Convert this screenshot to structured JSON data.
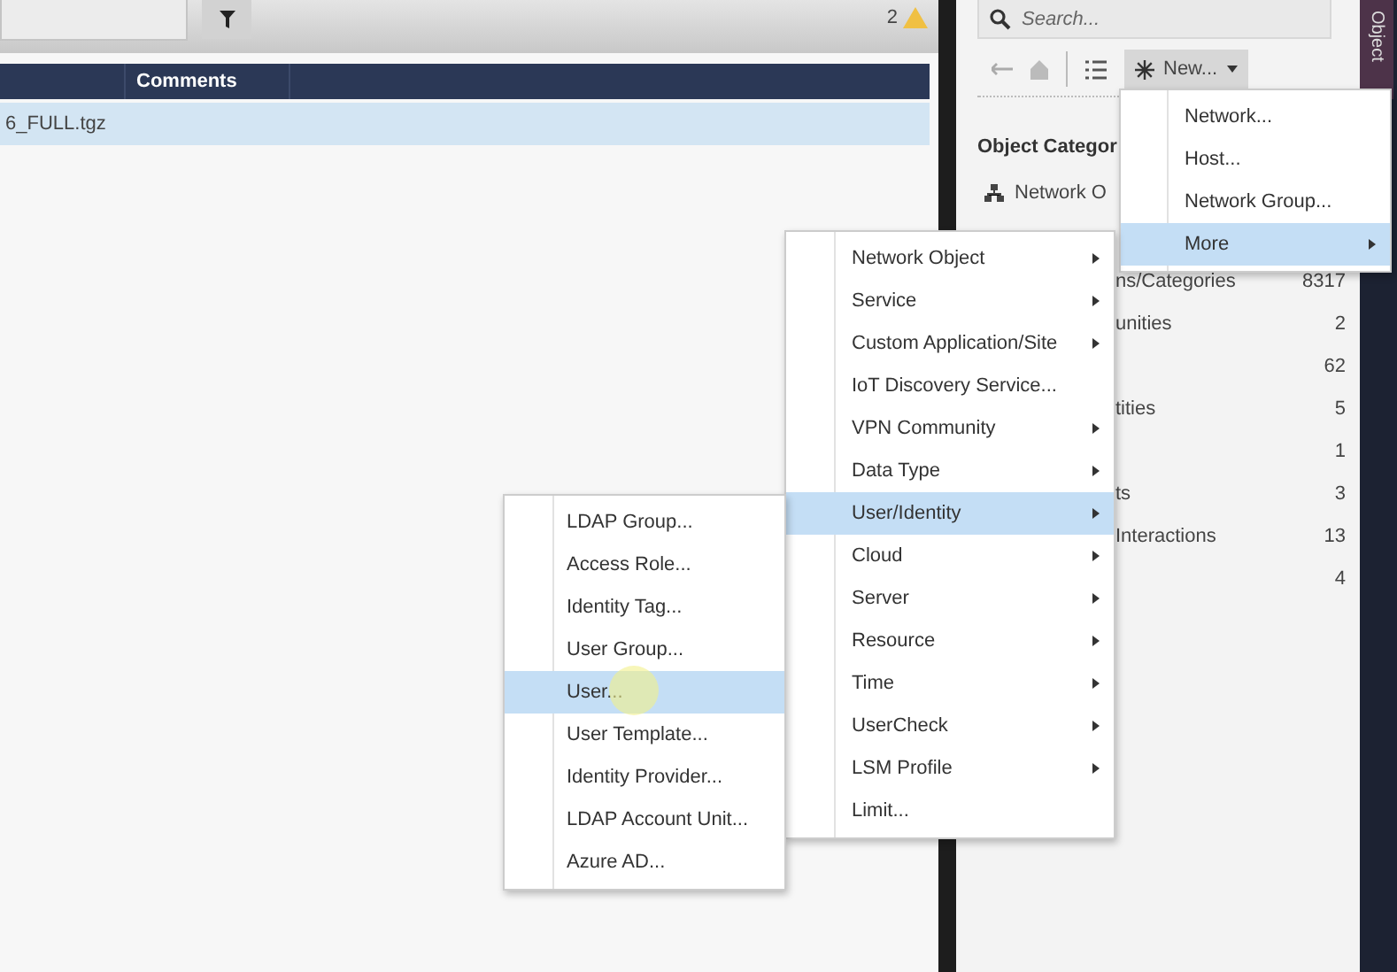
{
  "toolbar": {
    "warning_count": "2"
  },
  "table": {
    "columns": [
      "Comments"
    ],
    "rows": [
      {
        "column_1": "6_FULL.tgz",
        "selected": true
      }
    ]
  },
  "search": {
    "placeholder": "Search..."
  },
  "new_button": {
    "label": "New..."
  },
  "object_categories": {
    "title": "Object Categor",
    "items": [
      {
        "kind": "icon",
        "name": "Network O"
      },
      {
        "kind": "cut",
        "name": "ns/Categories",
        "count": "8317"
      },
      {
        "kind": "cut",
        "name": "unities",
        "count": "2"
      },
      {
        "kind": "cut",
        "count": "62"
      },
      {
        "kind": "cut",
        "name": "tities",
        "count": "5"
      },
      {
        "kind": "cut",
        "count": "1"
      },
      {
        "kind": "cut",
        "name": "ts",
        "count": "3"
      },
      {
        "kind": "cut",
        "name": "Interactions",
        "count": "13"
      },
      {
        "kind": "cut",
        "count": "4"
      }
    ]
  },
  "side_tab": {
    "label": "Object"
  },
  "menus": [
    {
      "items": [
        {
          "label": "Network...",
          "selected": false,
          "submenu": false
        },
        {
          "label": "Host...",
          "selected": false,
          "submenu": false
        },
        {
          "label": "Network Group...",
          "selected": false,
          "submenu": false
        },
        {
          "label": "More",
          "selected": true,
          "submenu": true
        }
      ]
    },
    {
      "items": [
        {
          "label": "Network Object",
          "selected": false,
          "submenu": true
        },
        {
          "label": "Service",
          "selected": false,
          "submenu": true
        },
        {
          "label": "Custom Application/Site",
          "selected": false,
          "submenu": true
        },
        {
          "label": "IoT Discovery Service...",
          "selected": false,
          "submenu": false
        },
        {
          "label": "VPN Community",
          "selected": false,
          "submenu": true
        },
        {
          "label": "Data Type",
          "selected": false,
          "submenu": true
        },
        {
          "label": "User/Identity",
          "selected": true,
          "submenu": true
        },
        {
          "label": "Cloud",
          "selected": false,
          "submenu": true
        },
        {
          "label": "Server",
          "selected": false,
          "submenu": true
        },
        {
          "label": "Resource",
          "selected": false,
          "submenu": true
        },
        {
          "label": "Time",
          "selected": false,
          "submenu": true
        },
        {
          "label": "UserCheck",
          "selected": false,
          "submenu": true
        },
        {
          "label": "LSM Profile",
          "selected": false,
          "submenu": true
        },
        {
          "label": "Limit...",
          "selected": false,
          "submenu": false
        }
      ]
    },
    {
      "items": [
        {
          "label": "LDAP Group...",
          "selected": false,
          "submenu": false
        },
        {
          "label": "Access Role...",
          "selected": false,
          "submenu": false
        },
        {
          "label": "Identity Tag...",
          "selected": false,
          "submenu": false
        },
        {
          "label": "User Group...",
          "selected": false,
          "submenu": false
        },
        {
          "label": "User...",
          "selected": true,
          "submenu": false
        },
        {
          "label": "User Template...",
          "selected": false,
          "submenu": false
        },
        {
          "label": "Identity Provider...",
          "selected": false,
          "submenu": false
        },
        {
          "label": "LDAP Account Unit...",
          "selected": false,
          "submenu": false
        },
        {
          "label": "Azure AD...",
          "selected": false,
          "submenu": false
        }
      ]
    }
  ]
}
